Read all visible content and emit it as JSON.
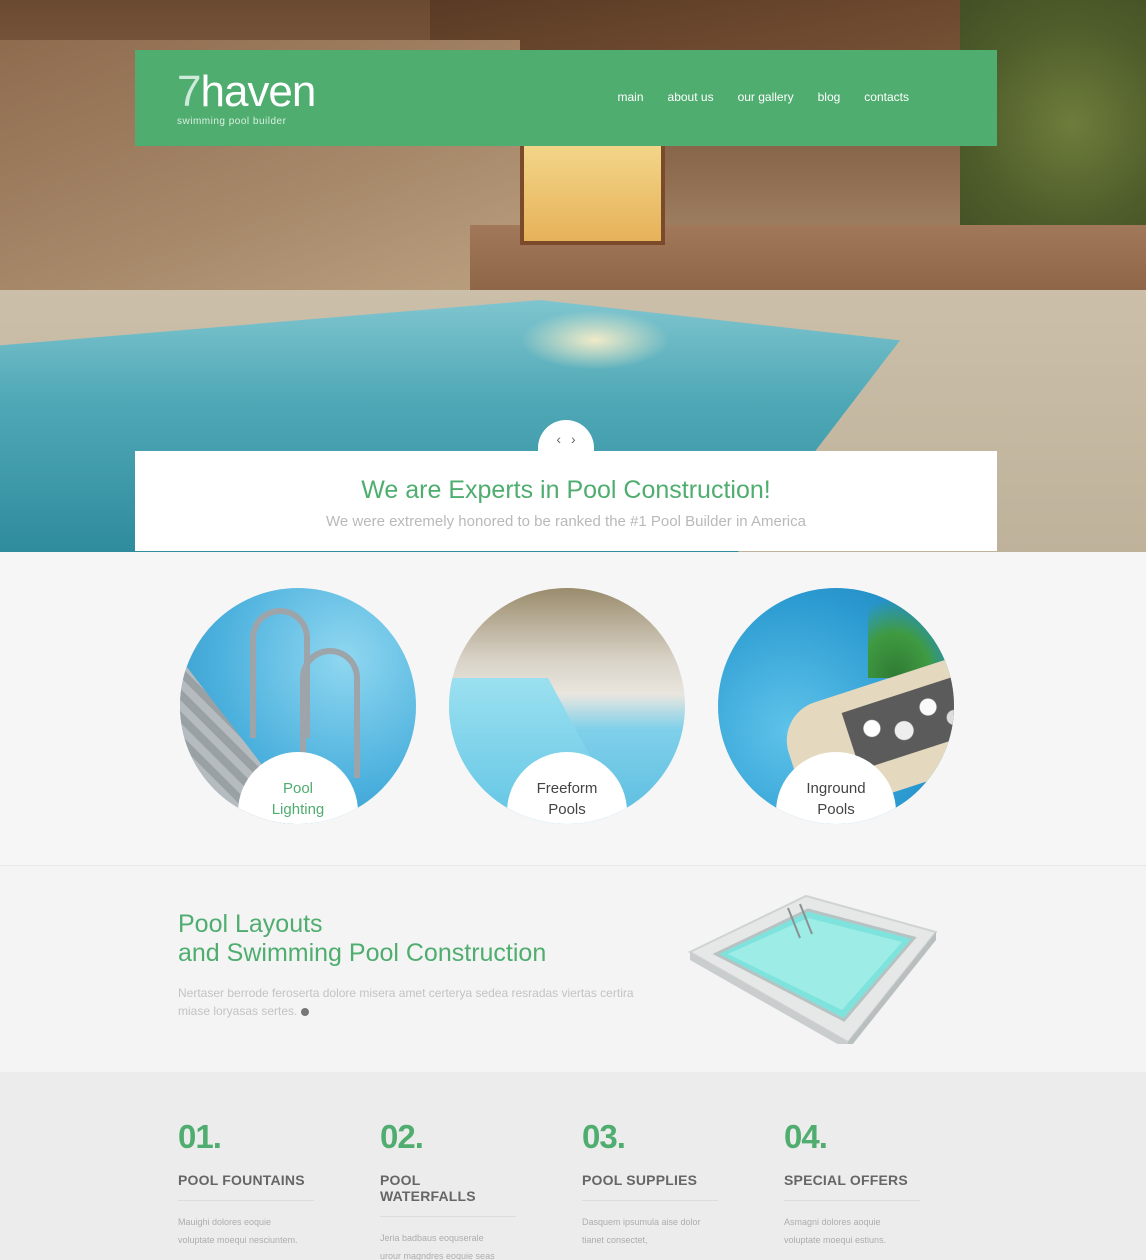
{
  "header": {
    "logo_num": "7",
    "logo_word": "haven",
    "logo_sub": "swimming pool builder",
    "nav": [
      "main",
      "about us",
      "our gallery",
      "blog",
      "contacts"
    ]
  },
  "hero": {
    "slider_prev": "‹",
    "slider_next": "›"
  },
  "banner": {
    "title": "We are Experts in Pool Construction!",
    "subtitle": "We were extremely honored to be ranked the #1 Pool Builder in America"
  },
  "services": [
    {
      "line1": "Pool",
      "line2": "Lighting"
    },
    {
      "line1": "Freeform",
      "line2": "Pools"
    },
    {
      "line1": "Inground",
      "line2": "Pools"
    }
  ],
  "layouts": {
    "title_line1": "Pool Layouts",
    "title_line2": "and Swimming Pool Construction",
    "text": "Nertaser berrode feroserta dolore misera amet certerya sedea resradas viertas certira miase loryasas sertes."
  },
  "features": [
    {
      "num": "01.",
      "title": "POOL FOUNTAINS",
      "text": "Mauighi dolores eoquie voluptate moequi nesciuntem."
    },
    {
      "num": "02.",
      "title": "POOL WATERFALLS",
      "text": "Jeria badbaus eoquserale urour magndres eoquie seas"
    },
    {
      "num": "03.",
      "title": "POOL SUPPLIES",
      "text": "Dasquem ipsumula aise dolor tianet consectet,"
    },
    {
      "num": "04.",
      "title": "SPECIAL OFFERS",
      "text": "Asmagni dolores aoquie voluptate moequi estiuns."
    }
  ],
  "colors": {
    "accent": "#4fad6f"
  }
}
